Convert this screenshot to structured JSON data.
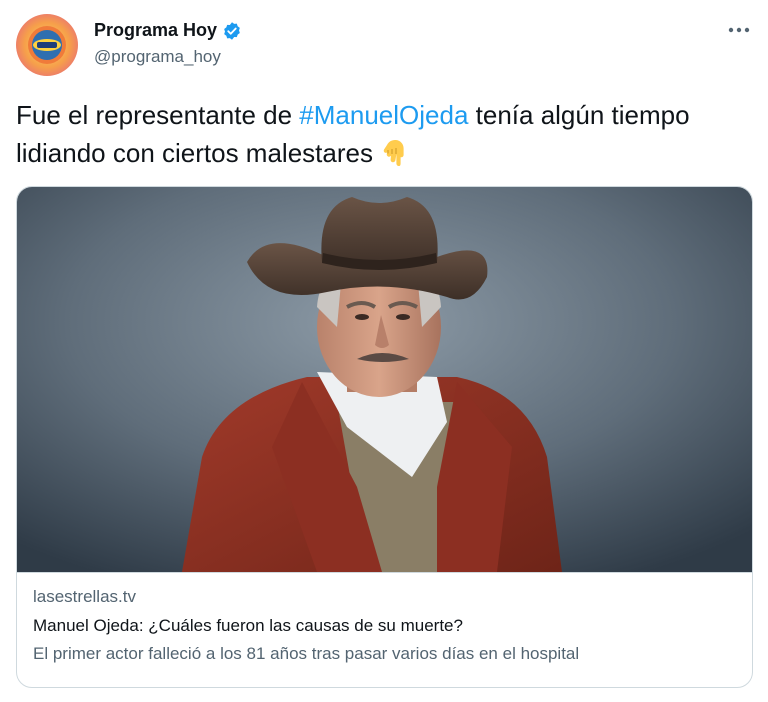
{
  "author": {
    "display_name": "Programa Hoy",
    "handle": "@programa_hoy",
    "verified": true,
    "avatar_icon": "programa-hoy-logo-icon"
  },
  "more_icon": "more-dots-icon",
  "tweet": {
    "text_before": "Fue el representante de ",
    "hashtag": "#ManuelOjeda",
    "text_after": " tenía algún tiempo lidiando con ciertos malestares",
    "emoji": "backhand-index-pointing-down-icon"
  },
  "card": {
    "image_alt": "portrait-photo",
    "domain": "lasestrellas.tv",
    "title": "Manuel Ojeda: ¿Cuáles fueron las causas de su muerte?",
    "description": "El primer actor falleció a los 81 años tras pasar varios días en el hospital"
  },
  "colors": {
    "link": "#1d9bf0",
    "secondary_text": "#536471",
    "border": "#cfd9de"
  }
}
